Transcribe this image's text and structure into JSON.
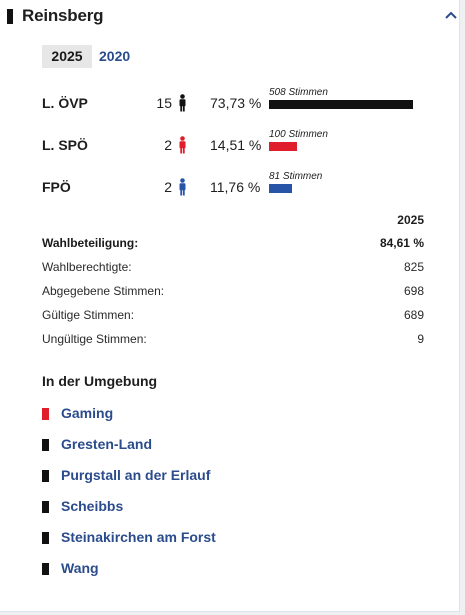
{
  "colors": {
    "black": "#111111",
    "red": "#e01d2a",
    "blue": "#2854a8",
    "link": "#2b4c8c"
  },
  "municipality": {
    "title": "Reinsberg",
    "collapse_icon": "chevron-up-icon"
  },
  "years": {
    "active": "2025",
    "other": "2020"
  },
  "parties": [
    {
      "name": "L. ÖVP",
      "seats": "15",
      "percent": "73,73 %",
      "votes": "508 Stimmen",
      "share": 0.7373,
      "color": "#111111"
    },
    {
      "name": "L. SPÖ",
      "seats": "2",
      "percent": "14,51 %",
      "votes": "100 Stimmen",
      "share": 0.1451,
      "color": "#e01d2a"
    },
    {
      "name": "FPÖ",
      "seats": "2",
      "percent": "11,76 %",
      "votes": "81 Stimmen",
      "share": 0.1176,
      "color": "#2854a8"
    }
  ],
  "stats": {
    "year": "2025",
    "rows": [
      {
        "label": "Wahlbeteiligung:",
        "value": "84,61 %"
      },
      {
        "label": "Wahlberechtigte:",
        "value": "825"
      },
      {
        "label": "Abgegebene Stimmen:",
        "value": "698"
      },
      {
        "label": "Gültige Stimmen:",
        "value": "689"
      },
      {
        "label": "Ungültige Stimmen:",
        "value": "9"
      }
    ]
  },
  "nearby": {
    "title": "In der Umgebung",
    "items": [
      {
        "label": "Gaming",
        "marker_color": "#e01d2a"
      },
      {
        "label": "Gresten-Land",
        "marker_color": "#111111"
      },
      {
        "label": "Purgstall an der Erlauf",
        "marker_color": "#111111"
      },
      {
        "label": "Scheibbs",
        "marker_color": "#111111"
      },
      {
        "label": "Steinakirchen am Forst",
        "marker_color": "#111111"
      },
      {
        "label": "Wang",
        "marker_color": "#111111"
      }
    ]
  }
}
